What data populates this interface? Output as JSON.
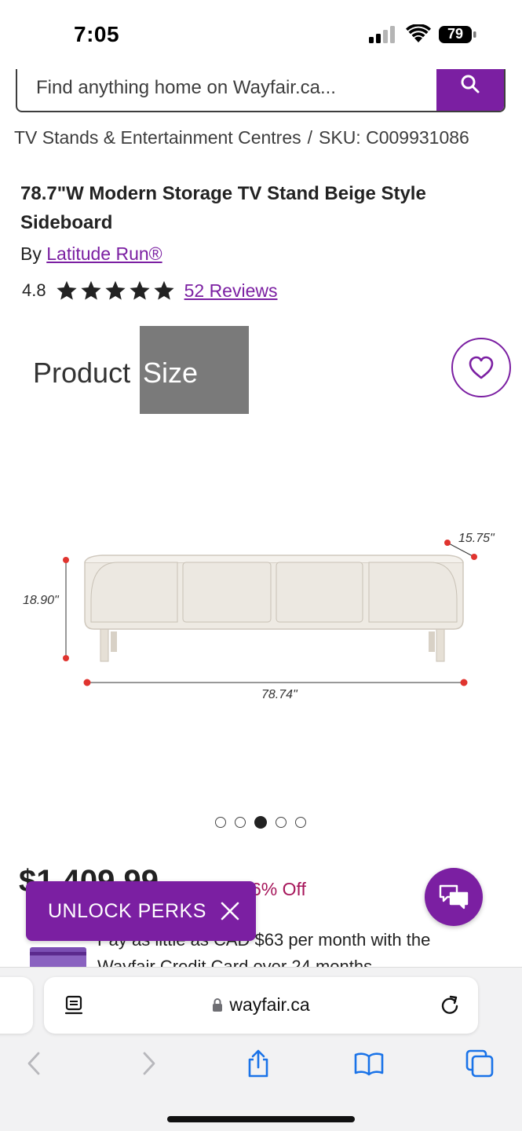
{
  "status_bar": {
    "time": "7:05",
    "battery": "79"
  },
  "search": {
    "placeholder": "Find anything home on Wayfair.ca..."
  },
  "breadcrumb": {
    "category": "TV Stands & Entertainment Centres",
    "separator": "/",
    "sku": "SKU: C009931086"
  },
  "product": {
    "title": "78.7\"W Modern Storage TV Stand Beige Style Sideboard",
    "by_label": "By",
    "brand": "Latitude Run®",
    "rating": "4.8",
    "stars": 5,
    "reviews_label": "52 Reviews"
  },
  "image": {
    "title_part1": "Product",
    "title_part2": "Size",
    "dim_depth": "15.75\"",
    "dim_height": "18.90\"",
    "dim_width": "78.74\"",
    "carousel_total": 5,
    "carousel_active": 3
  },
  "pricing": {
    "price": "$1,409.99",
    "discount": "6% Off",
    "credit_line1": "Pay as little as CAD $63 per month with the",
    "credit_line2": "Wayfair Credit Card over 24 months"
  },
  "promo": {
    "label": "UNLOCK PERKS"
  },
  "browser": {
    "url": "wayfair.ca"
  },
  "colors": {
    "brand_purple": "#7b1fa2",
    "discount": "#a6155a",
    "ios_blue": "#1a73e8"
  },
  "icons": [
    "search-icon",
    "heart-icon",
    "chat-icon",
    "close-icon",
    "lock-icon",
    "reader-icon",
    "reload-icon",
    "back-icon",
    "forward-icon",
    "share-icon",
    "bookmarks-icon",
    "tabs-icon"
  ]
}
